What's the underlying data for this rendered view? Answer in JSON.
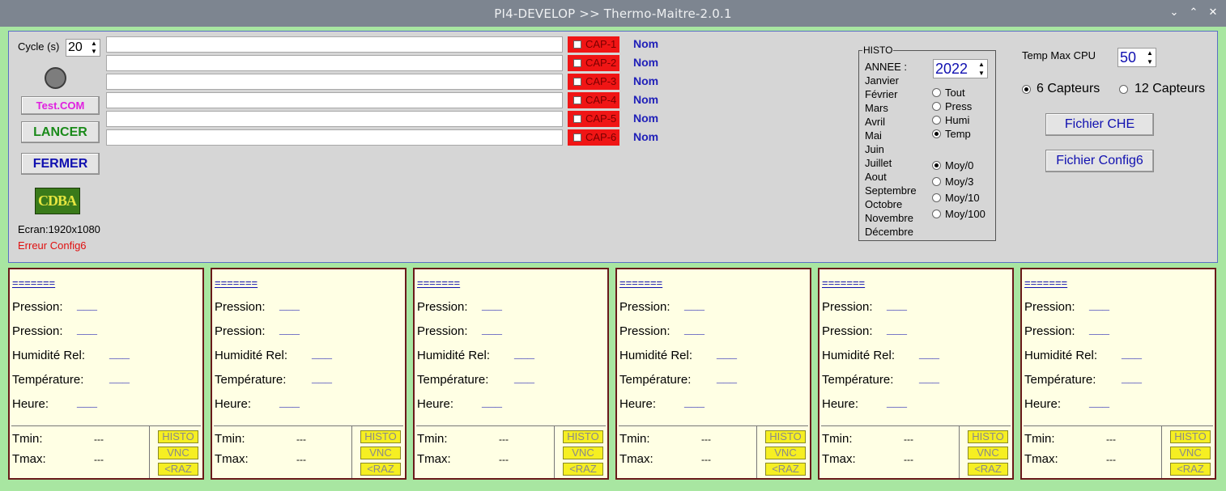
{
  "window": {
    "title": "PI4-DEVELOP >> Thermo-Maitre-2.0.1",
    "controls": [
      "⌄",
      "⌃",
      "✕"
    ]
  },
  "left": {
    "cycle_label": "Cycle (s)",
    "cycle_value": "20",
    "test_com": "Test.COM",
    "lancer": "LANCER",
    "fermer": "FERMER",
    "logo_text": "CDBA",
    "screen_info": "Ecran:1920x1080",
    "error": "Erreur Config6"
  },
  "captors": [
    {
      "cap": "CAP-1",
      "nom": "Nom"
    },
    {
      "cap": "CAP-2",
      "nom": "Nom"
    },
    {
      "cap": "CAP-3",
      "nom": "Nom"
    },
    {
      "cap": "CAP-4",
      "nom": "Nom"
    },
    {
      "cap": "CAP-5",
      "nom": "Nom"
    },
    {
      "cap": "CAP-6",
      "nom": "Nom"
    }
  ],
  "histo": {
    "legend": "HISTO",
    "annee_label": "ANNEE :",
    "annee_value": "2022",
    "months": [
      "Janvier",
      "Février",
      "Mars",
      "Avril",
      "Mai",
      "Juin",
      "Juillet",
      "Aout",
      "Septembre",
      "Octobre",
      "Novembre",
      "Décembre"
    ],
    "types": [
      "Tout",
      "Press",
      "Humi",
      "Temp"
    ],
    "selected_type": "Temp",
    "moys": [
      "Moy/0",
      "Moy/3",
      "Moy/10",
      "Moy/100"
    ],
    "selected_moy": "Moy/0"
  },
  "right": {
    "temp_max_label": "Temp Max CPU",
    "temp_max_value": "50",
    "six_capteurs": "6 Capteurs",
    "douze_capteurs": "12 Capteurs",
    "selected_capteurs": "6 Capteurs",
    "fichier_che": "Fichier CHE",
    "fichier_config6": "Fichier Config6"
  },
  "sensor_labels": {
    "name": "=======",
    "pression1": "Pression:",
    "pression2": "Pression:",
    "humidite": "Humidité Rel:",
    "temperature": "Température:",
    "heure": "Heure:",
    "tmin": "Tmin:",
    "tmax": "Tmax:",
    "histo_btn": "HISTO",
    "vnc_btn": "VNC",
    "raz_btn": "<RAZ"
  },
  "sensors": [
    {
      "pression1": "___",
      "pression2": "___",
      "humidite": "___",
      "temperature": "___",
      "heure": "___",
      "tmin": "---",
      "tmax": "---"
    },
    {
      "pression1": "___",
      "pression2": "___",
      "humidite": "___",
      "temperature": "___",
      "heure": "___",
      "tmin": "---",
      "tmax": "---"
    },
    {
      "pression1": "___",
      "pression2": "___",
      "humidite": "___",
      "temperature": "___",
      "heure": "___",
      "tmin": "---",
      "tmax": "---"
    },
    {
      "pression1": "___",
      "pression2": "___",
      "humidite": "___",
      "temperature": "___",
      "heure": "___",
      "tmin": "---",
      "tmax": "---"
    },
    {
      "pression1": "___",
      "pression2": "___",
      "humidite": "___",
      "temperature": "___",
      "heure": "___",
      "tmin": "---",
      "tmax": "---"
    },
    {
      "pression1": "___",
      "pression2": "___",
      "humidite": "___",
      "temperature": "___",
      "heure": "___",
      "tmin": "---",
      "tmax": "---"
    }
  ],
  "colors": {
    "frame": "#a8e6a1",
    "panel": "#d6d6d6",
    "sensor_bg": "#ffffe4",
    "cap_red": "#f01515",
    "value_blue": "#1010b0",
    "yellow_btn": "#f6ef22"
  }
}
